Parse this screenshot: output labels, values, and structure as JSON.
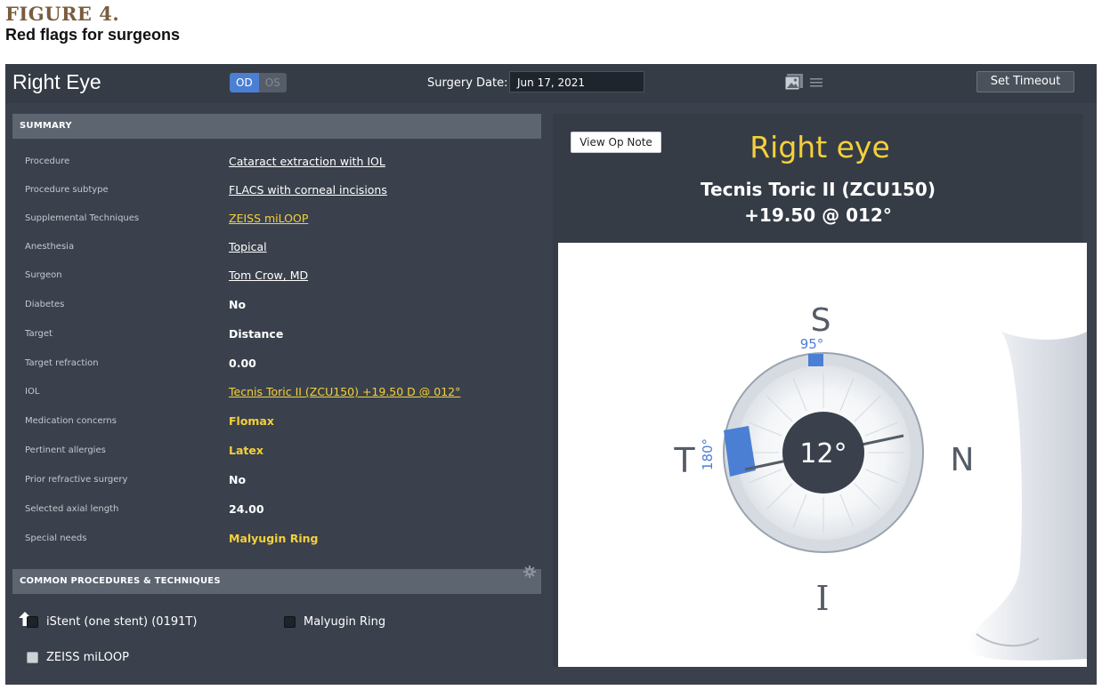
{
  "figure": {
    "title": "FIGURE 4.",
    "subtitle": "Red flags for surgeons"
  },
  "header": {
    "eye_title": "Right Eye",
    "toggle": {
      "active": "OD",
      "inactive": "OS"
    },
    "surgery_date_label": "Surgery Date:",
    "surgery_date_value": "Jun 17, 2021",
    "set_timeout_label": "Set Timeout",
    "icons": [
      "image-icon",
      "list-icon"
    ]
  },
  "summary": {
    "heading": "SUMMARY",
    "rows": [
      {
        "label": "Procedure",
        "value": "Cataract extraction with IOL"
      },
      {
        "label": "Procedure subtype",
        "value": "FLACS with corneal incisions"
      },
      {
        "label": "Supplemental Techniques",
        "value": "ZEISS miLOOP"
      },
      {
        "label": "Anesthesia",
        "value": "Topical"
      },
      {
        "label": "Surgeon",
        "value": "Tom Crow, MD"
      },
      {
        "label": "Diabetes",
        "value": "No"
      },
      {
        "label": "Target",
        "value": "Distance"
      },
      {
        "label": "Target refraction",
        "value": "0.00"
      },
      {
        "label": "IOL",
        "value": "Tecnis Toric II (ZCU150) +19.50 D @ 012°"
      },
      {
        "label": "Medication concerns",
        "value": "Flomax"
      },
      {
        "label": "Pertinent allergies",
        "value": "Latex"
      },
      {
        "label": "Prior refractive surgery",
        "value": "No"
      },
      {
        "label": "Selected axial length",
        "value": "24.00"
      },
      {
        "label": "Special needs",
        "value": "Malyugin Ring"
      }
    ]
  },
  "common": {
    "heading": "COMMON PROCEDURES & TECHNIQUES",
    "items": [
      "iStent (one stent) (0191T)",
      "Malyugin Ring",
      "ZEISS miLOOP"
    ]
  },
  "eye_panel": {
    "view_op_note": "View Op Note",
    "title": "Right eye",
    "lens_name": "Tecnis Toric II (ZCU150)",
    "lens_power": "+19.50 @ 012°",
    "axis_center": "12°",
    "labels": {
      "S": "S",
      "I": "I",
      "T": "T",
      "N": "N"
    },
    "marker_top": "95°",
    "marker_left": "180°",
    "colors": {
      "accent": "#4a7fd4",
      "highlight": "#f5d03a",
      "panel": "#3a414c"
    }
  }
}
